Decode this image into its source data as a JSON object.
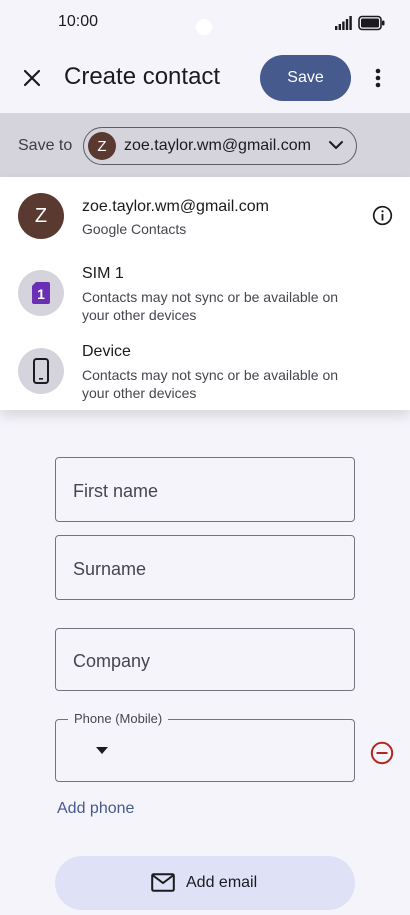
{
  "status_bar": {
    "time": "10:00"
  },
  "app_bar": {
    "title": "Create contact",
    "save_label": "Save"
  },
  "save_to": {
    "label": "Save to",
    "avatar_letter": "Z",
    "account_email": "zoe.taylor.wm@gmail.com"
  },
  "dropdown": {
    "options": [
      {
        "title": "zoe.taylor.wm@gmail.com",
        "subtitle": "Google Contacts",
        "avatar_letter": "Z",
        "icon": "avatar-icon"
      },
      {
        "title": "SIM 1",
        "subtitle": "Contacts may not sync or be available on your other devices",
        "icon": "sim-card-icon",
        "badge": "1"
      },
      {
        "title": "Device",
        "subtitle": "Contacts may not sync or be available on your other devices",
        "icon": "phone-device-icon"
      }
    ]
  },
  "form": {
    "first_name_placeholder": "First name",
    "surname_placeholder": "Surname",
    "company_placeholder": "Company",
    "phone_label": "Phone (Mobile)",
    "add_phone_label": "Add phone",
    "add_email_label": "Add email"
  },
  "colors": {
    "primary": "#465a8e",
    "sim_purple": "#6a2fb2",
    "remove_red": "#b3261e",
    "avatar_brown": "#5a3a30"
  }
}
